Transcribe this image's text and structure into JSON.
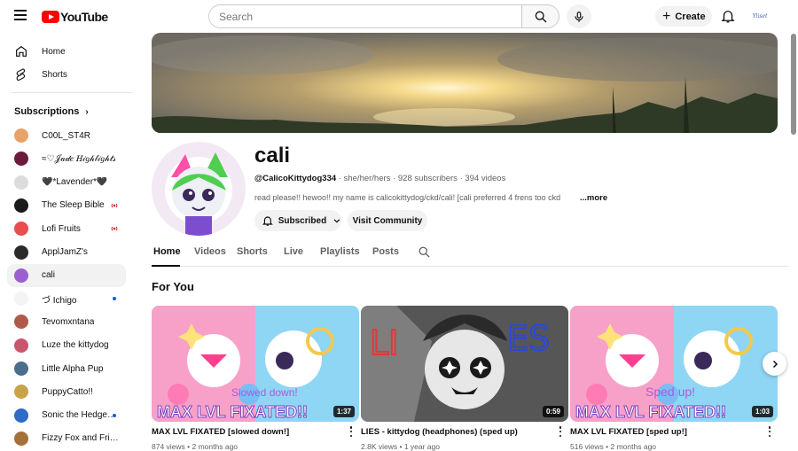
{
  "header": {
    "logo_text": "YouTube",
    "search_placeholder": "Search",
    "create_label": "Create",
    "avatar_text": "Yliset"
  },
  "sidebar": {
    "home": "Home",
    "shorts": "Shorts",
    "subscriptions_title": "Subscriptions",
    "subs": [
      {
        "label": "C00L_ST4R",
        "color": "#e8a36b",
        "indicator": ""
      },
      {
        "label": "≈♡𝒥𝒶𝒹𝑒 𝐻𝒾𝑔𝒽𝓁𝒾𝑔𝒽𝓉𝓈",
        "color": "#6b1b3b",
        "indicator": ""
      },
      {
        "label": "🖤*Lavender*🖤",
        "color": "#dcdcdc",
        "indicator": ""
      },
      {
        "label": "The Sleep Bible",
        "color": "#1a1a1a",
        "indicator": "live"
      },
      {
        "label": "Lofi Fruits",
        "color": "#e94d4d",
        "indicator": "live"
      },
      {
        "label": "ApplJamZ's",
        "color": "#2a2a2a",
        "indicator": ""
      },
      {
        "label": "cali",
        "color": "#9c5fd0",
        "indicator": ""
      },
      {
        "label": "づ Ichigo",
        "color": "#f4f4f4",
        "indicator": "dot"
      },
      {
        "label": "Tevomxntana",
        "color": "#b05a4a",
        "indicator": ""
      },
      {
        "label": "Luze the kittydog",
        "color": "#c8576d",
        "indicator": ""
      },
      {
        "label": "Little Alpha Pup",
        "color": "#4b6e8c",
        "indicator": ""
      },
      {
        "label": "PuppyCatto!!",
        "color": "#c9a34a",
        "indicator": ""
      },
      {
        "label": "Sonic the Hedgehog",
        "color": "#2d6bc4",
        "indicator": "dot"
      },
      {
        "label": "Fizzy Fox and Friends",
        "color": "#a5703a",
        "indicator": ""
      }
    ]
  },
  "channel": {
    "name": "cali",
    "handle": "@CalicoKittydog334",
    "pronouns": "she/her/hers",
    "subscribers": "928 subscribers",
    "videos": "394 videos",
    "description": "read please!! hewoo!! my name is calicokittydog/ckd/cali! [cali preferred 4 frens too ckd",
    "more": "...more",
    "subscribed_label": "Subscribed",
    "community_label": "Visit Community"
  },
  "tabs": [
    "Home",
    "Videos",
    "Shorts",
    "Live",
    "Playlists",
    "Posts"
  ],
  "section_title": "For You",
  "videos": [
    {
      "title": "MAX LVL FIXATED [slowed down!]",
      "views": "874 views",
      "age": "2 months ago",
      "duration": "1:37",
      "thumb_text": "MAX LVL FIXATED!!",
      "thumb_sub": "Slowed down!"
    },
    {
      "title": "LIES - kittydog (headphones) (sped up)",
      "views": "2.8K views",
      "age": "1 year ago",
      "duration": "0:59",
      "thumb_text": "LIES",
      "thumb_sub": ""
    },
    {
      "title": "MAX LVL FIXATED [sped up!]",
      "views": "516 views",
      "age": "2 months ago",
      "duration": "1:03",
      "thumb_text": "MAX LVL FIXATED!!",
      "thumb_sub": "Sped up!"
    }
  ],
  "colors": {
    "brand_red": "#ff0000",
    "text_primary": "#0f0f0f",
    "text_secondary": "#606060",
    "chip_bg": "#f2f2f2"
  }
}
